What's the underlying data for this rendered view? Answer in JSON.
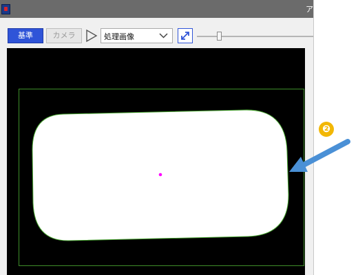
{
  "window": {
    "title_fragment": "ア"
  },
  "toolbar": {
    "base_label": "基準",
    "camera_label": "カメラ",
    "view_select": {
      "value": "処理画像"
    },
    "zoom_level": 0.21
  },
  "image_view": {
    "background": "#000000",
    "roi_color": "#3f8f2a",
    "object_color": "#ffffff",
    "center_marker_color": "#ff00ff"
  },
  "annotation": {
    "step_number": "❷",
    "badge_color": "#f2b705",
    "arrow_color": "#4a90d6"
  },
  "icons": {
    "app": "app-icon",
    "play": "play-icon",
    "dropdown": "chevron-down-icon",
    "expand": "expand-icon"
  }
}
